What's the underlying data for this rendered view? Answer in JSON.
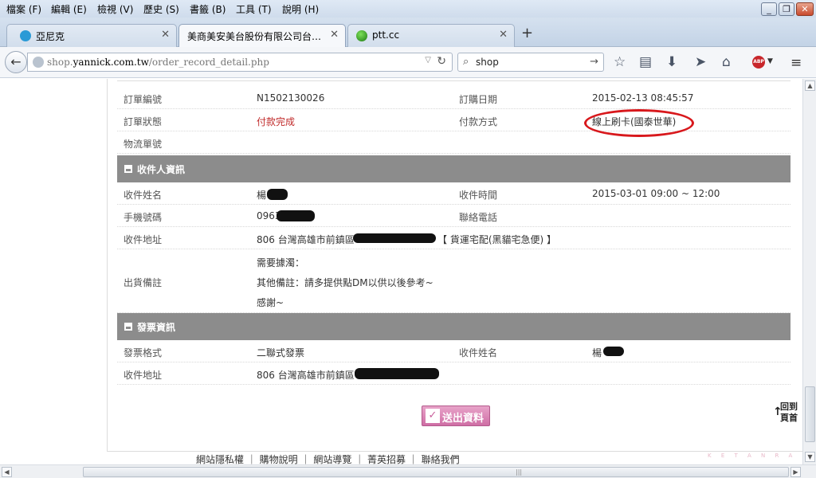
{
  "menubar": {
    "items": [
      "檔案 (F)",
      "編輯 (E)",
      "檢視 (V)",
      "歷史 (S)",
      "書籤 (B)",
      "工具 (T)",
      "說明 (H)"
    ]
  },
  "tabs": [
    {
      "label": "亞尼克",
      "active": false
    },
    {
      "label": "美商美安美台股份有限公司台…",
      "active": true
    },
    {
      "label": "ptt.cc",
      "active": false
    }
  ],
  "navbar": {
    "url_prefix": "shop.",
    "url_domain": "yannick.com.tw",
    "url_path": "/order_record_detail.php",
    "search_value": "shop"
  },
  "order": {
    "order_no_label": "訂單編號",
    "order_no": "N1502130026",
    "order_date_label": "訂購日期",
    "order_date": "2015-02-13 08:45:57",
    "status_label": "訂單狀態",
    "status": "付款完成",
    "payment_label": "付款方式",
    "payment": "線上刷卡(國泰世華)",
    "logistics_label": "物流單號"
  },
  "recipient": {
    "section_title": "收件人資訊",
    "name_label": "收件姓名",
    "name": "楊",
    "time_label": "收件時間",
    "time": "2015-03-01 09:00 ~ 12:00",
    "mobile_label": "手機號碼",
    "mobile": "0963",
    "phone_label": "聯絡電話",
    "address_label": "收件地址",
    "address": "806 台灣高雄市前鎮區",
    "delivery": "【 貨運宅配(黑貓宅急便) 】",
    "note_label": "出貨備註",
    "note_lines": [
      "需要據濁：",
      "其他備註：請多提供點DM以供以後參考~",
      "感謝~"
    ]
  },
  "invoice": {
    "section_title": "發票資訊",
    "format_label": "發票格式",
    "format": "二聯式發票",
    "name_label": "收件姓名",
    "name": "楊",
    "address_label": "收件地址",
    "address": "806 台灣高雄市前鎮區"
  },
  "actions": {
    "submit_label": "送出資料",
    "top_line1": "回到",
    "top_line2": "頁首"
  },
  "footer": {
    "links": [
      "網站隱私權",
      "購物說明",
      "網站導覽",
      "菁英招募",
      "聯絡我們"
    ],
    "watermark": "K E T A N R A"
  },
  "colors": {
    "section_bg": "#8c8c8c",
    "status_red": "#c02a2a",
    "highlight_circle": "#d8181c",
    "submit_pink": "#cf6ea5"
  }
}
